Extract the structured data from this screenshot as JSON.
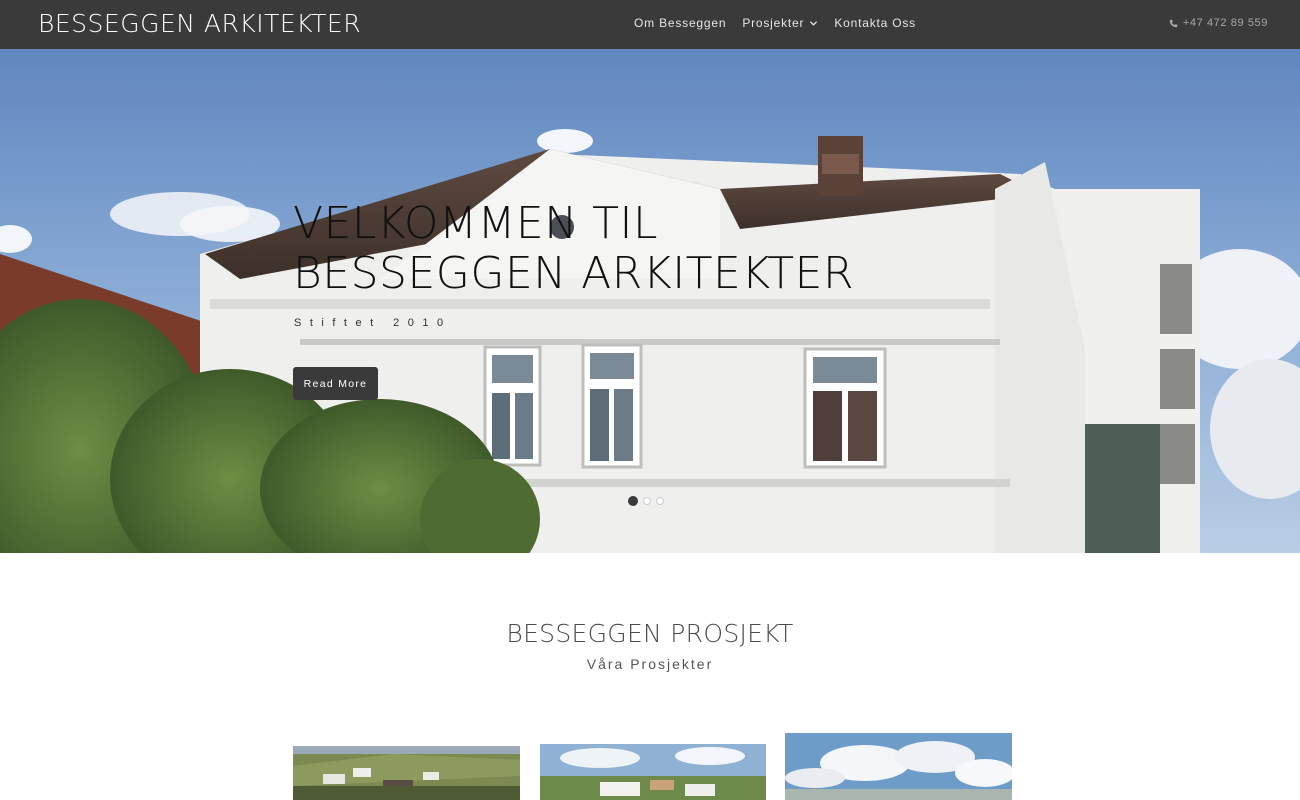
{
  "header": {
    "brand": "BESSEGGEN ARKITEKTER",
    "nav": [
      {
        "label": "Om Besseggen"
      },
      {
        "label": "Prosjekter",
        "has_dropdown": true
      },
      {
        "label": "Kontakta Oss"
      }
    ],
    "phone": "+47 472 89 559",
    "phone_icon": "phone-icon"
  },
  "hero": {
    "title": "VELKOMMEN TIL BESSEGGEN ARKITEKTER",
    "subtitle": "Stiftet 2010",
    "button_label": "Read More",
    "slides_total": 3,
    "active_slide": 1
  },
  "projects": {
    "title": "BESSEGGEN PROSJEKT",
    "subtitle": "Våra Prosjekter",
    "items_visible": 3
  },
  "colors": {
    "header_bg": "#3a3a3a",
    "button_bg": "#3a3a3a",
    "text_dark": "#111111"
  }
}
